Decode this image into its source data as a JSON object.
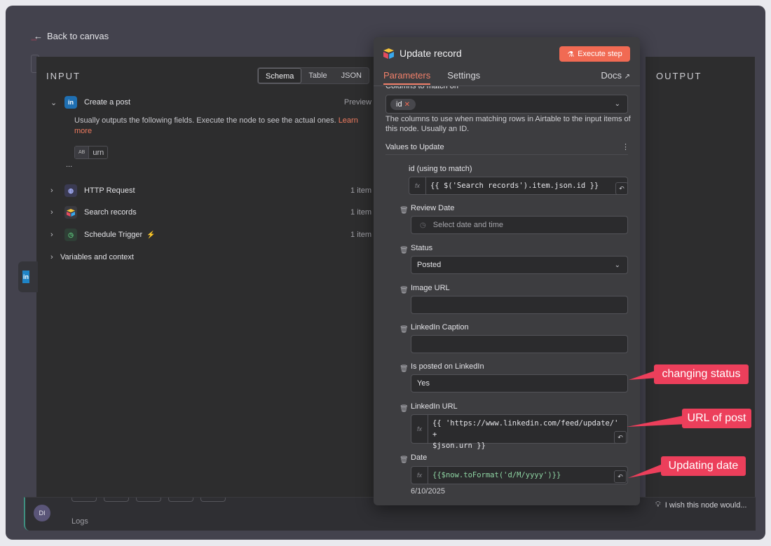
{
  "nav": {
    "back_label": "Back to canvas"
  },
  "input_panel": {
    "title": "INPUT",
    "view_tabs": [
      "Schema",
      "Table",
      "JSON"
    ],
    "first_node": {
      "name": "Create a post",
      "right": "Preview",
      "description": "Usually outputs the following fields. Execute the node to see the actual ones.",
      "learn_more": "Learn more",
      "field_type": "AB",
      "field_name": "urn",
      "more": "..."
    },
    "nodes": [
      {
        "name": "HTTP Request",
        "count": "1 item",
        "icon": "globe-icon"
      },
      {
        "name": "Search records",
        "count": "1 item",
        "icon": "airtable-icon"
      },
      {
        "name": "Schedule Trigger",
        "count": "1 item",
        "icon": "clock-icon"
      }
    ],
    "variables_label": "Variables and context"
  },
  "output_panel": {
    "title": "OUTPUT"
  },
  "bottom": {
    "avatar": "DI",
    "logs": "Logs",
    "feedback": "I wish this node would..."
  },
  "modal": {
    "title": "Update record",
    "execute_label": "Execute step",
    "tabs": {
      "parameters": "Parameters",
      "settings": "Settings",
      "docs": "Docs"
    },
    "columns_label": "Columns to match on",
    "columns_value": "id",
    "columns_hint": "The columns to use when matching rows in Airtable to the input items of this node. Usually an ID.",
    "values_label": "Values to Update",
    "fields": {
      "id_label": "id (using to match)",
      "id_expr": "{{ $('Search records').item.json.id }}",
      "review_date_label": "Review Date",
      "review_date_placeholder": "Select date and time",
      "status_label": "Status",
      "status_value": "Posted",
      "image_url_label": "Image URL",
      "caption_label": "LinkedIn Caption",
      "posted_label": "Is posted on LinkedIn",
      "posted_value": "Yes",
      "linkedin_url_label": "LinkedIn URL",
      "linkedin_url_expr_1": "{{ 'https://www.linkedin.com/feed/update/' +",
      "linkedin_url_expr_2": "$json.urn }}",
      "date_label": "Date",
      "date_expr": "{{$now.toFormat('d/M/yyyy')}}",
      "date_result": "6/10/2025"
    }
  },
  "annotations": {
    "status": "changing status",
    "url": "URL of post",
    "date": "Updating date",
    "color": "#ec3f5b"
  }
}
